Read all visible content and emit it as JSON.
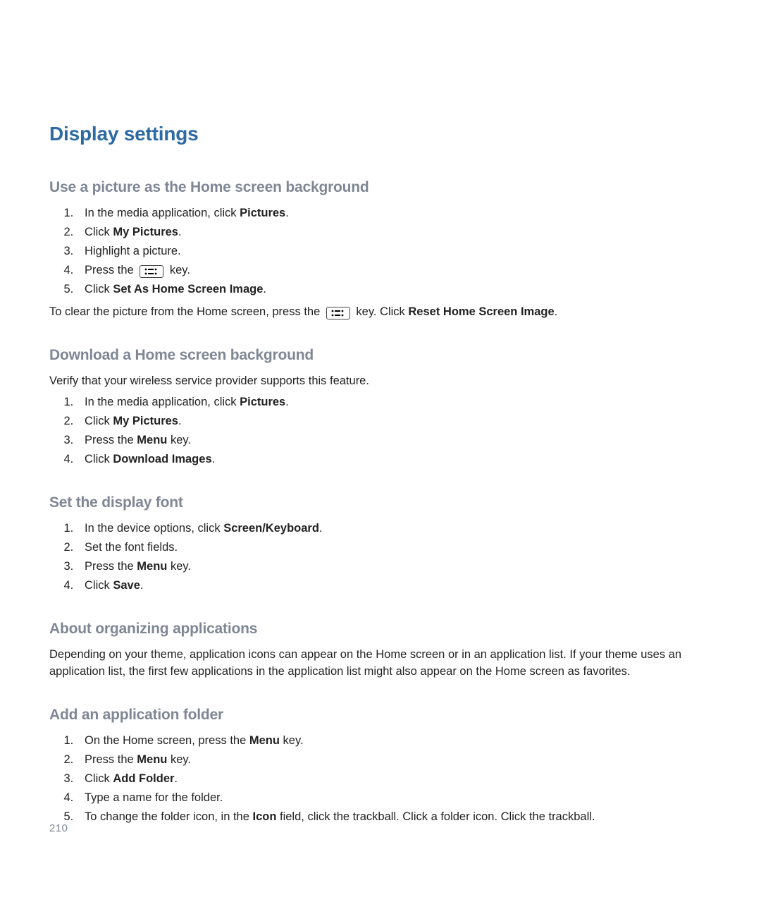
{
  "title": "Display settings",
  "page_number": "210",
  "section1": {
    "heading": "Use a picture as the Home screen background",
    "step1_pre": "In the media application, click ",
    "step1_bold": "Pictures",
    "step2_pre": "Click ",
    "step2_bold": "My Pictures",
    "step3": "Highlight a picture.",
    "step4_pre": "Press the ",
    "step4_post": " key.",
    "step5_pre": "Click ",
    "step5_bold": "Set As Home Screen Image",
    "footer_pre": "To clear the picture from the Home screen, press the ",
    "footer_mid": " key. Click ",
    "footer_bold": "Reset Home Screen Image"
  },
  "section2": {
    "heading": "Download a Home screen background",
    "intro": "Verify that your wireless service provider supports this feature.",
    "step1_pre": "In the media application, click ",
    "step1_bold": "Pictures",
    "step2_pre": "Click ",
    "step2_bold": "My Pictures",
    "step3_pre": "Press the ",
    "step3_bold": "Menu",
    "step3_post": " key.",
    "step4_pre": "Click ",
    "step4_bold": "Download Images"
  },
  "section3": {
    "heading": "Set the display font",
    "step1_pre": "In the device options, click ",
    "step1_bold": "Screen/Keyboard",
    "step2": "Set the font fields.",
    "step3_pre": "Press the ",
    "step3_bold": "Menu",
    "step3_post": " key.",
    "step4_pre": "Click ",
    "step4_bold": "Save"
  },
  "section4": {
    "heading": "About organizing applications",
    "body": "Depending on your theme, application icons can appear on the Home screen or in an application list. If your theme uses an application list, the first few applications in the application list might also appear on the Home screen as favorites."
  },
  "section5": {
    "heading": "Add an application folder",
    "step1_pre": "On the Home screen, press the ",
    "step1_bold": "Menu",
    "step1_post": " key.",
    "step2_pre": "Press the ",
    "step2_bold": "Menu",
    "step2_post": " key.",
    "step3_pre": "Click ",
    "step3_bold": "Add Folder",
    "step4": "Type a name for the folder.",
    "step5_pre": "To change the folder icon, in the ",
    "step5_bold": "Icon",
    "step5_post": " field, click the trackball. Click a folder icon. Click the trackball."
  }
}
